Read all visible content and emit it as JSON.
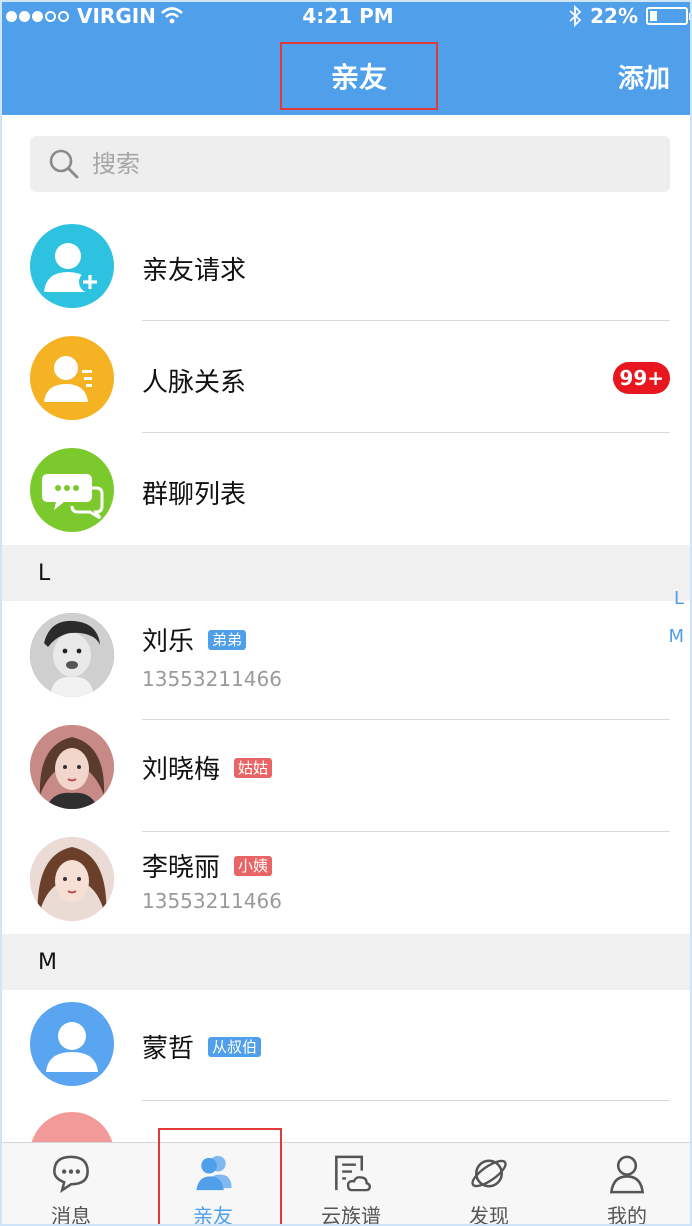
{
  "status_bar": {
    "carrier": "VIRGIN",
    "time": "4:21 PM",
    "battery": "22%"
  },
  "header": {
    "title": "亲友",
    "add_label": "添加"
  },
  "search": {
    "placeholder": "搜索"
  },
  "menu_items": [
    {
      "label": "亲友请求",
      "icon": "add-user-icon",
      "color": "#2dc3e0"
    },
    {
      "label": "人脉关系",
      "icon": "contacts-icon",
      "color": "#f5b223",
      "badge": "99+"
    },
    {
      "label": "群聊列表",
      "icon": "chat-bubbles-icon",
      "color": "#7cc92e"
    }
  ],
  "sections": [
    {
      "letter": "L",
      "contacts": [
        {
          "name": "刘乐",
          "tag": "弟弟",
          "tag_color": "blue",
          "phone": "13553211466"
        },
        {
          "name": "刘晓梅",
          "tag": "姑姑",
          "tag_color": "red",
          "phone": ""
        },
        {
          "name": "李晓丽",
          "tag": "小姨",
          "tag_color": "red",
          "phone": "13553211466"
        }
      ]
    },
    {
      "letter": "M",
      "contacts": [
        {
          "name": "蒙哲",
          "tag": "从叔伯",
          "tag_color": "blue",
          "phone": ""
        }
      ]
    }
  ],
  "index_letters": [
    "L",
    "M"
  ],
  "tabs": [
    {
      "label": "消息",
      "icon": "message-icon",
      "active": false
    },
    {
      "label": "亲友",
      "icon": "friends-icon",
      "active": true
    },
    {
      "label": "云族谱",
      "icon": "family-tree-icon",
      "active": false
    },
    {
      "label": "发现",
      "icon": "planet-icon",
      "active": false
    },
    {
      "label": "我的",
      "icon": "profile-icon",
      "active": false
    }
  ],
  "colors": {
    "primary": "#4f9fea",
    "badge_red": "#e8171f",
    "tag_red": "#e96565",
    "highlight_red": "#e23a3a"
  }
}
